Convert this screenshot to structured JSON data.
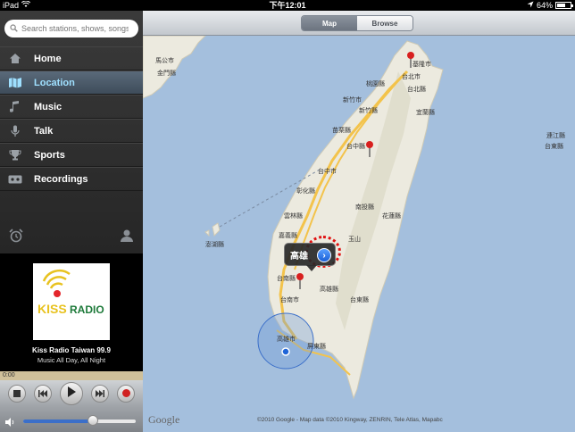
{
  "statusbar": {
    "device": "iPad",
    "time": "下午12:01",
    "battery": "64%",
    "battery_level": 0.64
  },
  "sidebar": {
    "search_placeholder": "Search stations, shows, songs...",
    "items": [
      {
        "label": "Home",
        "icon": "home-icon"
      },
      {
        "label": "Location",
        "icon": "map-icon",
        "active": true
      },
      {
        "label": "Music",
        "icon": "music-note-icon"
      },
      {
        "label": "Talk",
        "icon": "microphone-icon"
      },
      {
        "label": "Sports",
        "icon": "trophy-icon"
      },
      {
        "label": "Recordings",
        "icon": "cassette-icon"
      }
    ]
  },
  "player": {
    "logo_text": "KISS RADIO",
    "station_name": "Kiss Radio Taiwan 99.9",
    "tagline": "Music All Day, All Night",
    "elapsed": "0:00",
    "volume": 0.62
  },
  "map": {
    "segments": {
      "map": "Map",
      "browse": "Browse"
    },
    "active_segment": "map",
    "callout": "高雄",
    "watermark": "Google",
    "copyright": "©2010 Google - Map data ©2010 Kingway, ZENRIN, Tele Atlas, Mapabc",
    "labels": [
      "基隆市",
      "台北市",
      "台北縣",
      "桃園縣",
      "新竹市",
      "新竹縣",
      "宜蘭縣",
      "苗栗縣",
      "台中市",
      "台中縣",
      "彰化縣",
      "南投縣",
      "雲林縣",
      "花蓮縣",
      "嘉義縣",
      "玉山",
      "台南縣",
      "台南市",
      "高雄縣",
      "台東縣",
      "高雄市",
      "屏東縣",
      "澎湖縣",
      "馬公市",
      "金門縣",
      "連江縣",
      "台東縣"
    ],
    "colors": {
      "sea": "#a4bfdd",
      "land": "#eceadf",
      "highway": "#f3c34b",
      "pin": "#d8201f",
      "accent": "#e01010"
    }
  }
}
